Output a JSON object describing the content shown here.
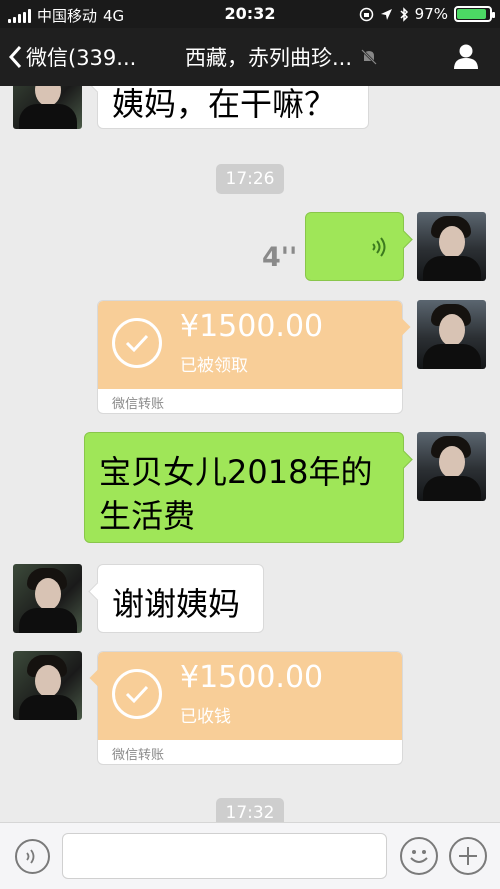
{
  "status_bar": {
    "carrier": "中国移动",
    "network": "4G",
    "time": "20:32",
    "battery": "97%",
    "battery_level": 0.97,
    "icons": [
      "signal-icon",
      "rotation-lock-icon",
      "location-icon",
      "bluetooth-icon",
      "battery-icon"
    ]
  },
  "nav": {
    "back_label": "微信(339...",
    "title": "西藏，赤列曲珍...",
    "mute_icon": "mute-bell-icon",
    "profile_icon": "person-icon"
  },
  "messages": {
    "m1_text": "姨妈，在干嘛？",
    "ts1": "17:26",
    "voice_duration": "4''",
    "transfer1_amount": "¥1500.00",
    "transfer1_status": "已被领取",
    "transfer1_label": "微信转账",
    "m3_text_line1": "宝贝女儿2018年的",
    "m3_text_line2": "生活费",
    "m4_text": "谢谢姨妈",
    "transfer2_amount": "¥1500.00",
    "transfer2_status": "已收钱",
    "transfer2_label": "微信转账",
    "ts2": "17:32"
  },
  "input_bar": {
    "icons": [
      "voice-icon",
      "emoji-icon",
      "plus-icon"
    ]
  },
  "colors": {
    "green_bubble": "#9fe658",
    "transfer_orange": "#f8ce98",
    "nav_bg": "#1f1f1f",
    "chat_bg": "#ebebeb"
  }
}
